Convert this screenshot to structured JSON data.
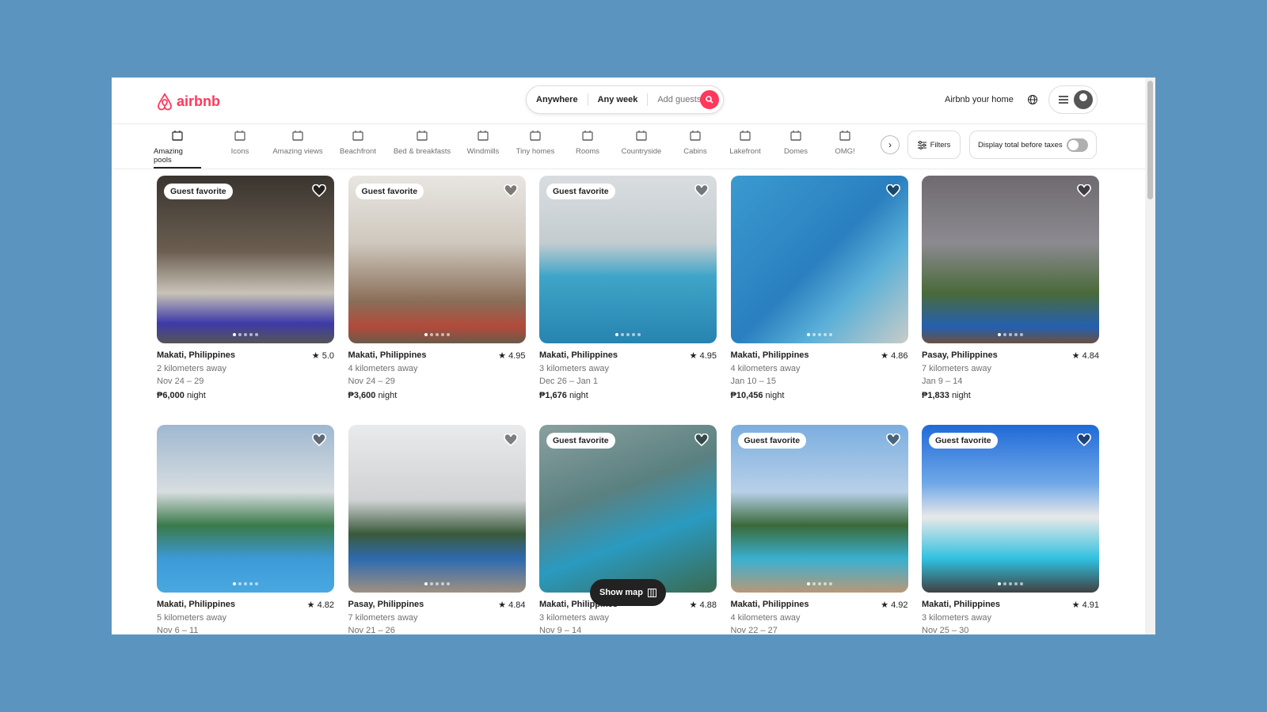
{
  "header": {
    "logo_text": "airbnb",
    "search": {
      "where": "Anywhere",
      "when": "Any week",
      "guests": "Add guests"
    },
    "host_link": "Airbnb your home",
    "brand_color": "#ff385c"
  },
  "categories": [
    {
      "label": "Amazing pools",
      "icon": "pool-icon",
      "active": true
    },
    {
      "label": "Icons",
      "icon": "ticket-star-icon"
    },
    {
      "label": "Amazing views",
      "icon": "view-icon"
    },
    {
      "label": "Beachfront",
      "icon": "beach-icon"
    },
    {
      "label": "Bed & breakfasts",
      "icon": "mug-icon"
    },
    {
      "label": "Windmills",
      "icon": "windmill-icon"
    },
    {
      "label": "Tiny homes",
      "icon": "tiny-home-icon"
    },
    {
      "label": "Rooms",
      "icon": "bed-icon"
    },
    {
      "label": "Countryside",
      "icon": "countryside-icon"
    },
    {
      "label": "Cabins",
      "icon": "cabin-icon"
    },
    {
      "label": "Lakefront",
      "icon": "lakefront-icon"
    },
    {
      "label": "Domes",
      "icon": "dome-icon"
    },
    {
      "label": "OMG!",
      "icon": "ufo-icon"
    }
  ],
  "filters_label": "Filters",
  "taxes_label": "Display total before taxes",
  "taxes_toggle_on": false,
  "badge_label": "Guest favorite",
  "show_map_label": "Show map",
  "listings": [
    {
      "location": "Makati, Philippines",
      "rating": "5.0",
      "distance": "2 kilometers away",
      "dates": "Nov 24 – 29",
      "price": "₱6,000",
      "unit": "night",
      "favorite": true
    },
    {
      "location": "Makati, Philippines",
      "rating": "4.95",
      "distance": "4 kilometers away",
      "dates": "Nov 24 – 29",
      "price": "₱3,600",
      "unit": "night",
      "favorite": true
    },
    {
      "location": "Makati, Philippines",
      "rating": "4.95",
      "distance": "3 kilometers away",
      "dates": "Dec 26 – Jan 1",
      "price": "₱1,676",
      "unit": "night",
      "favorite": true
    },
    {
      "location": "Makati, Philippines",
      "rating": "4.86",
      "distance": "4 kilometers away",
      "dates": "Jan 10 – 15",
      "price": "₱10,456",
      "unit": "night",
      "favorite": false
    },
    {
      "location": "Pasay, Philippines",
      "rating": "4.84",
      "distance": "7 kilometers away",
      "dates": "Jan 9 – 14",
      "price": "₱1,833",
      "unit": "night",
      "favorite": false
    },
    {
      "location": "Makati, Philippines",
      "rating": "4.82",
      "distance": "5 kilometers away",
      "dates": "Nov 6 – 11",
      "favorite": false
    },
    {
      "location": "Pasay, Philippines",
      "rating": "4.84",
      "distance": "7 kilometers away",
      "dates": "Nov 21 – 26",
      "favorite": false
    },
    {
      "location": "Makati, Philippines",
      "rating": "4.88",
      "distance": "3 kilometers away",
      "dates": "Nov 9 – 14",
      "favorite": true
    },
    {
      "location": "Makati, Philippines",
      "rating": "4.92",
      "distance": "4 kilometers away",
      "dates": "Nov 22 – 27",
      "favorite": true
    },
    {
      "location": "Makati, Philippines",
      "rating": "4.91",
      "distance": "3 kilometers away",
      "dates": "Nov 25 – 30",
      "favorite": true
    }
  ]
}
